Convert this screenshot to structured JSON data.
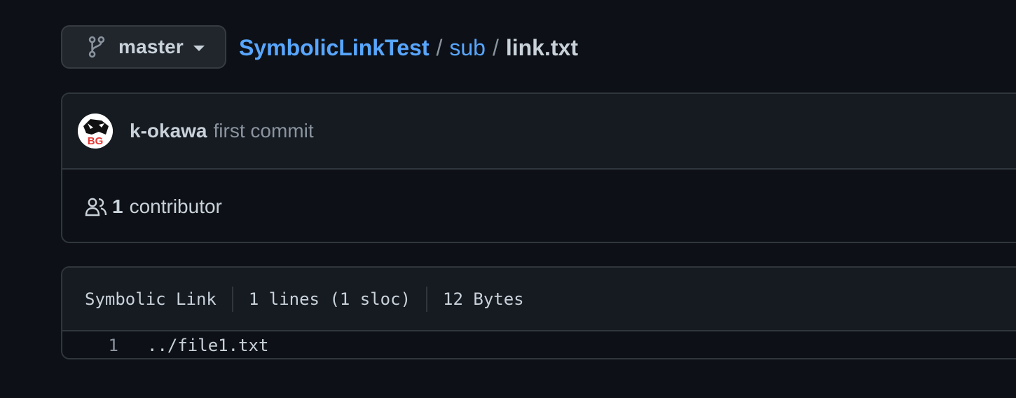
{
  "branch": {
    "icon": "git-branch-icon",
    "name": "master"
  },
  "breadcrumb": {
    "repo": "SymbolicLinkTest",
    "separator": "/",
    "dir": "sub",
    "file": "link.txt"
  },
  "commit": {
    "avatar_text": "BG",
    "author": "k-okawa",
    "message": "first commit"
  },
  "contributors": {
    "icon": "people-icon",
    "count": "1",
    "label": "contributor"
  },
  "file": {
    "type": "Symbolic Link",
    "lines": "1 lines (1 sloc)",
    "size": "12 Bytes",
    "code": [
      {
        "number": "1",
        "text": "../file1.txt"
      }
    ]
  },
  "colors": {
    "background": "#0d1117",
    "link": "#58a6ff",
    "muted": "#8b949e",
    "border": "#30363d",
    "header_bg": "#161b22"
  }
}
